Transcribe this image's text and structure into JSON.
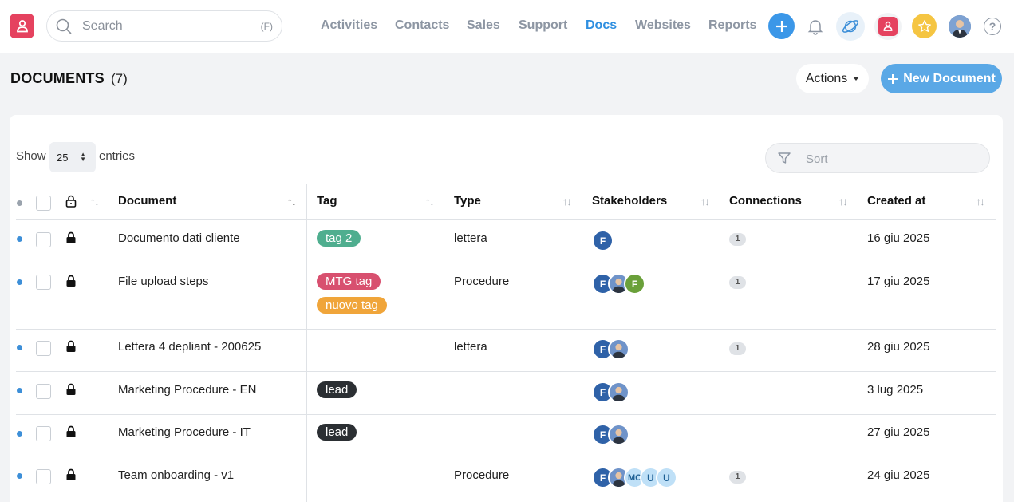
{
  "search": {
    "placeholder": "Search",
    "shortcut": "(F)"
  },
  "nav": {
    "items": [
      {
        "label": "Activities"
      },
      {
        "label": "Contacts"
      },
      {
        "label": "Sales"
      },
      {
        "label": "Support"
      },
      {
        "label": "Docs",
        "active": true
      },
      {
        "label": "Websites"
      },
      {
        "label": "Reports"
      }
    ]
  },
  "icons": {
    "logo": "brand-logo-icon",
    "add": "plus-icon",
    "notifications": "bell-icon",
    "planet": "planet-icon",
    "app": "brand-app-icon",
    "favorites": "star-icon",
    "user": "user-avatar",
    "help": "help-icon"
  },
  "colors": {
    "accent": "#2f8fe0",
    "brand": "#e5425f",
    "primary_button": "#5aa8e6",
    "row_dot": "#3d8fd8"
  },
  "header": {
    "title": "DOCUMENTS",
    "count": "(7)",
    "actions_label": "Actions",
    "new_label": "New Document"
  },
  "controls": {
    "show_label": "Show",
    "entries_value": "25",
    "entries_label": "entries",
    "sort_placeholder": "Sort"
  },
  "table": {
    "columns": [
      "Document",
      "Tag",
      "Type",
      "Stakeholders",
      "Connections",
      "Created at"
    ],
    "rows": [
      {
        "document": "Documento dati cliente",
        "tags": [
          {
            "label": "tag 2",
            "color": "#4fae8f"
          }
        ],
        "type": "lettera",
        "stakeholders": [
          "F"
        ],
        "connections": "1",
        "created": "16 giu 2025"
      },
      {
        "document": "File upload steps",
        "tags": [
          {
            "label": "MTG tag",
            "color": "#d8506f"
          },
          {
            "label": "nuovo tag",
            "color": "#f0a53a"
          }
        ],
        "type": "Procedure",
        "stakeholders": [
          "F",
          "photo",
          "F"
        ],
        "connections": "1",
        "created": "17 giu 2025"
      },
      {
        "document": "Lettera 4 depliant - 200625",
        "tags": [],
        "type": "lettera",
        "stakeholders": [
          "F",
          "photo"
        ],
        "connections": "1",
        "created": "28 giu 2025"
      },
      {
        "document": "Marketing Procedure - EN",
        "tags": [
          {
            "label": "lead",
            "color": "#2b2f33"
          }
        ],
        "type": "",
        "stakeholders": [
          "F",
          "photo"
        ],
        "connections": "",
        "created": "3 lug 2025"
      },
      {
        "document": "Marketing Procedure - IT",
        "tags": [
          {
            "label": "lead",
            "color": "#2b2f33"
          }
        ],
        "type": "",
        "stakeholders": [
          "F",
          "photo"
        ],
        "connections": "",
        "created": "27 giu 2025"
      },
      {
        "document": "Team onboarding - v1",
        "tags": [],
        "type": "Procedure",
        "stakeholders": [
          "F",
          "photo",
          "MC",
          "U",
          "U"
        ],
        "connections": "1",
        "created": "24 giu 2025"
      }
    ]
  }
}
